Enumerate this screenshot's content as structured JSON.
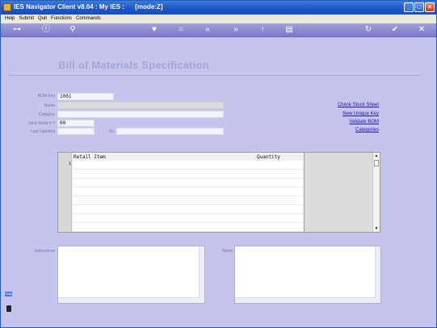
{
  "window": {
    "title": "IES Navigator Client v8.04 : My IES :      [mode:Z]",
    "controls": [
      "minimize",
      "maximize",
      "close"
    ]
  },
  "menu": [
    "Help",
    "Submit",
    "Quit",
    "Functions",
    "Commands"
  ],
  "toolbar_icons": [
    "key-icon",
    "info-icon",
    "search-icon",
    "heart-icon",
    "circle-icon",
    "back-icon",
    "forward-icon",
    "up-icon",
    "list-icon",
    "refresh-icon",
    "check-icon",
    "close-icon"
  ],
  "page": {
    "title": "Bill of Materials Specification"
  },
  "form": {
    "bom_key": {
      "label": "BOM Key",
      "value": "1001"
    },
    "name": {
      "label": "Name",
      "value": ""
    },
    "category": {
      "label": "Category",
      "value": ""
    },
    "next_serial": {
      "label": "Next Serial # ?",
      "value": "00"
    },
    "last_update": {
      "label": "Last Updated",
      "value": ""
    },
    "by": {
      "label": "By",
      "value": ""
    }
  },
  "links": [
    "Check Stock Sheet",
    "New Unique Key",
    "Validate BOM",
    "Categories"
  ],
  "grid": {
    "columns": [
      "Retail Item",
      "Quantity"
    ],
    "first_row_number": "1"
  },
  "memos": {
    "instructions_label": "Instructions",
    "notes_label": "Notes"
  },
  "side_badge": "Help"
}
